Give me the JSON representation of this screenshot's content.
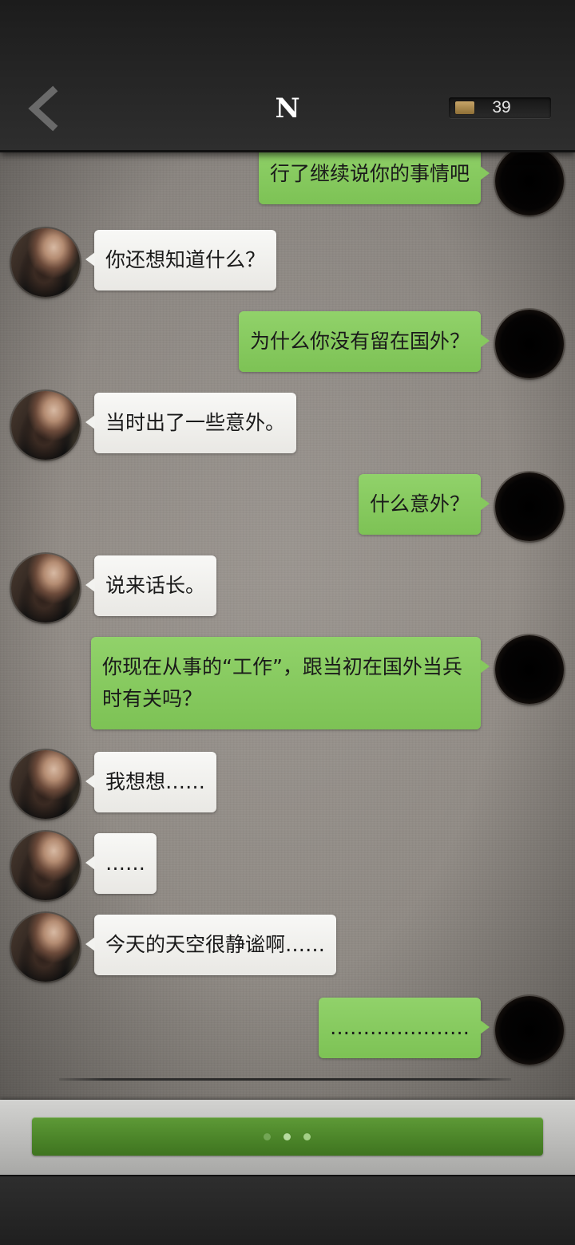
{
  "header": {
    "back_icon": "chevron-left-icon",
    "title": "N",
    "coin_icon": "gold-bar-icon",
    "coin_count": "39"
  },
  "messages": [
    {
      "sender": "self",
      "text": "行了继续说你的事情吧"
    },
    {
      "sender": "other",
      "text": "你还想知道什么？"
    },
    {
      "sender": "self",
      "text": "为什么你没有留在国外？"
    },
    {
      "sender": "other",
      "text": "当时出了一些意外。"
    },
    {
      "sender": "self",
      "text": "什么意外？"
    },
    {
      "sender": "other",
      "text": "说来话长。"
    },
    {
      "sender": "self",
      "text": "你现在从事的“工作”，跟当初在国外当兵时有关吗？"
    },
    {
      "sender": "other",
      "text": "我想想……"
    },
    {
      "sender": "other",
      "text": "……"
    },
    {
      "sender": "other",
      "text": "今天的天空很静谧啊……"
    },
    {
      "sender": "self",
      "text": "…………………"
    }
  ],
  "bottom": {
    "continue_indicator": "typing-dots"
  },
  "colors": {
    "self_bubble": "#86c85e",
    "other_bubble": "#f2f2ef",
    "continue_button": "#4a8328",
    "header_bg": "#262626"
  }
}
